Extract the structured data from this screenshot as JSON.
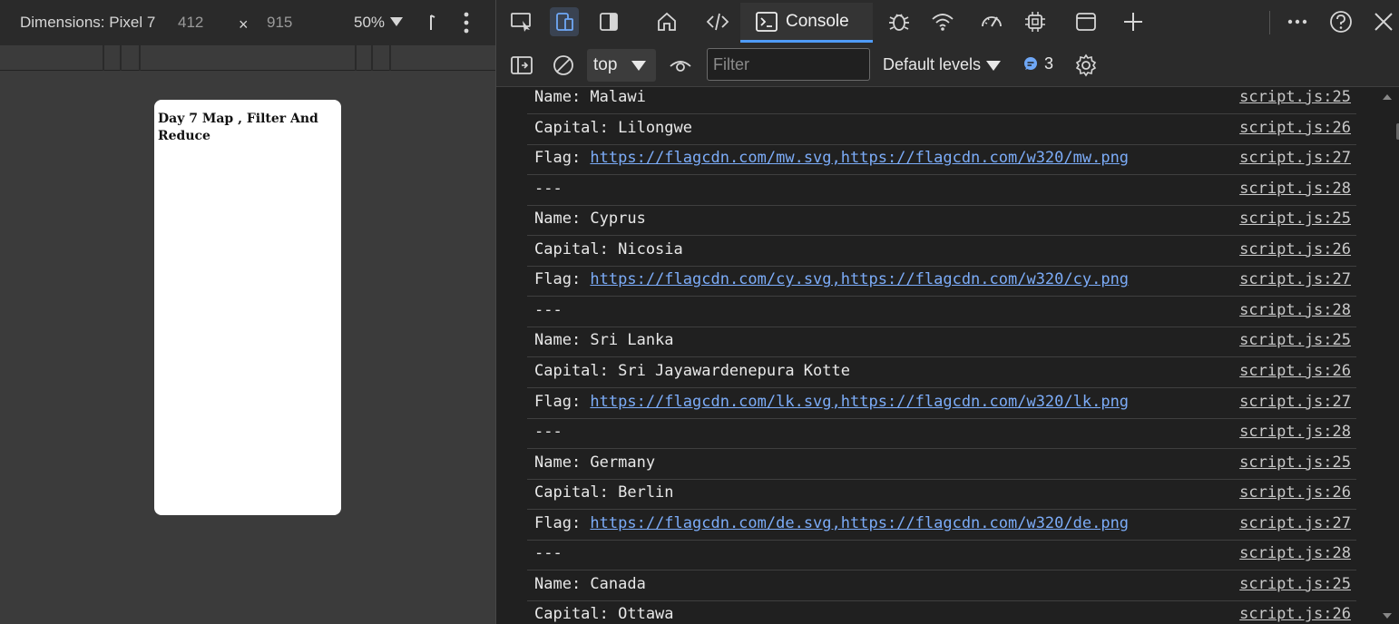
{
  "device_toolbar": {
    "dimensions_label": "Dimensions: Pixel 7",
    "width": "412",
    "times": "×",
    "height": "915",
    "zoom": "50%"
  },
  "page": {
    "heading": "Day 7 Map , Filter And Reduce"
  },
  "devtools": {
    "tabs": {
      "console_label": "Console"
    },
    "toolbar": {
      "context": "top",
      "filter_placeholder": "Filter",
      "levels_label": "Default levels",
      "issues_count": "3"
    },
    "colors": {
      "accent": "#4f9cf9",
      "link": "#7cacf8",
      "background": "#202020"
    },
    "messages": [
      {
        "text": "Name: Malawi",
        "source": "script.js:25"
      },
      {
        "text": "Capital: Lilongwe",
        "source": "script.js:26"
      },
      {
        "prefix": "Flag: ",
        "link": "https://flagcdn.com/mw.svg,https://flagcdn.com/w320/mw.png",
        "source": "script.js:27"
      },
      {
        "text": "---",
        "source": "script.js:28"
      },
      {
        "text": "Name: Cyprus",
        "source": "script.js:25"
      },
      {
        "text": "Capital: Nicosia",
        "source": "script.js:26"
      },
      {
        "prefix": "Flag: ",
        "link": "https://flagcdn.com/cy.svg,https://flagcdn.com/w320/cy.png",
        "source": "script.js:27"
      },
      {
        "text": "---",
        "source": "script.js:28"
      },
      {
        "text": "Name: Sri Lanka",
        "source": "script.js:25"
      },
      {
        "text": "Capital: Sri Jayawardenepura Kotte",
        "source": "script.js:26"
      },
      {
        "prefix": "Flag: ",
        "link": "https://flagcdn.com/lk.svg,https://flagcdn.com/w320/lk.png",
        "source": "script.js:27"
      },
      {
        "text": "---",
        "source": "script.js:28"
      },
      {
        "text": "Name: Germany",
        "source": "script.js:25"
      },
      {
        "text": "Capital: Berlin",
        "source": "script.js:26"
      },
      {
        "prefix": "Flag: ",
        "link": "https://flagcdn.com/de.svg,https://flagcdn.com/w320/de.png",
        "source": "script.js:27"
      },
      {
        "text": "---",
        "source": "script.js:28"
      },
      {
        "text": "Name: Canada",
        "source": "script.js:25"
      },
      {
        "text": "Capital: Ottawa",
        "source": "script.js:26"
      }
    ]
  }
}
